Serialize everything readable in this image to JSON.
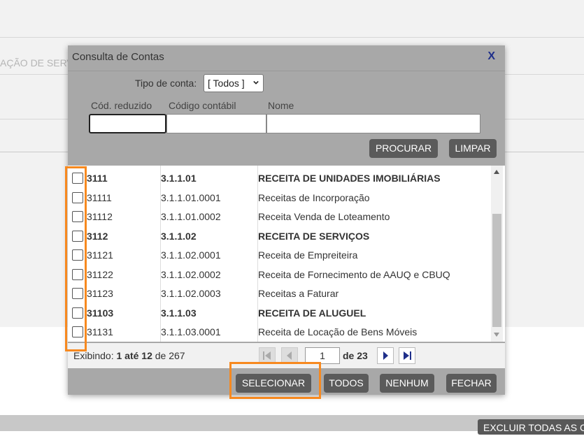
{
  "background": {
    "partial_text": "AÇÃO DE SERV",
    "bottom_button": "EXCLUIR TODAS AS C"
  },
  "dialog": {
    "title": "Consulta de Contas",
    "close": "X",
    "tipo_label": "Tipo de conta:",
    "tipo_value": "[ Todos ]",
    "columns": {
      "cod_reduzido": "Cód. reduzido",
      "codigo_contabil": "Código contábil",
      "nome": "Nome"
    },
    "search_button": "PROCURAR",
    "clear_button": "LIMPAR",
    "rows": [
      {
        "cod": "3111",
        "conta": "3.1.1.01",
        "nome": "RECEITA DE UNIDADES IMOBILIÁRIAS",
        "bold": true
      },
      {
        "cod": "31111",
        "conta": "3.1.1.01.0001",
        "nome": "Receitas de Incorporação",
        "bold": false
      },
      {
        "cod": "31112",
        "conta": "3.1.1.01.0002",
        "nome": "Receita Venda de Loteamento",
        "bold": false
      },
      {
        "cod": "3112",
        "conta": "3.1.1.02",
        "nome": "RECEITA DE SERVIÇOS",
        "bold": true
      },
      {
        "cod": "31121",
        "conta": "3.1.1.02.0001",
        "nome": "Receita de Empreiteira",
        "bold": false
      },
      {
        "cod": "31122",
        "conta": "3.1.1.02.0002",
        "nome": "Receita de Fornecimento de AAUQ e CBUQ",
        "bold": false
      },
      {
        "cod": "31123",
        "conta": "3.1.1.02.0003",
        "nome": "Receitas a Faturar",
        "bold": false
      },
      {
        "cod": "31103",
        "conta": "3.1.1.03",
        "nome": "RECEITA DE ALUGUEL",
        "bold": true
      },
      {
        "cod": "31131",
        "conta": "3.1.1.03.0001",
        "nome": "Receita de Locação de Bens Móveis",
        "bold": false
      }
    ],
    "footer": {
      "exibindo": "Exibindo:",
      "from": "1",
      "ate": "até",
      "to": "12",
      "de": "de",
      "total": "267",
      "page": "1",
      "of_pages": "de 23"
    },
    "actions": {
      "select": "SELECIONAR",
      "all": "TODOS",
      "none": "NENHUM",
      "close": "FECHAR"
    }
  },
  "highlight_color": "#f7891f"
}
